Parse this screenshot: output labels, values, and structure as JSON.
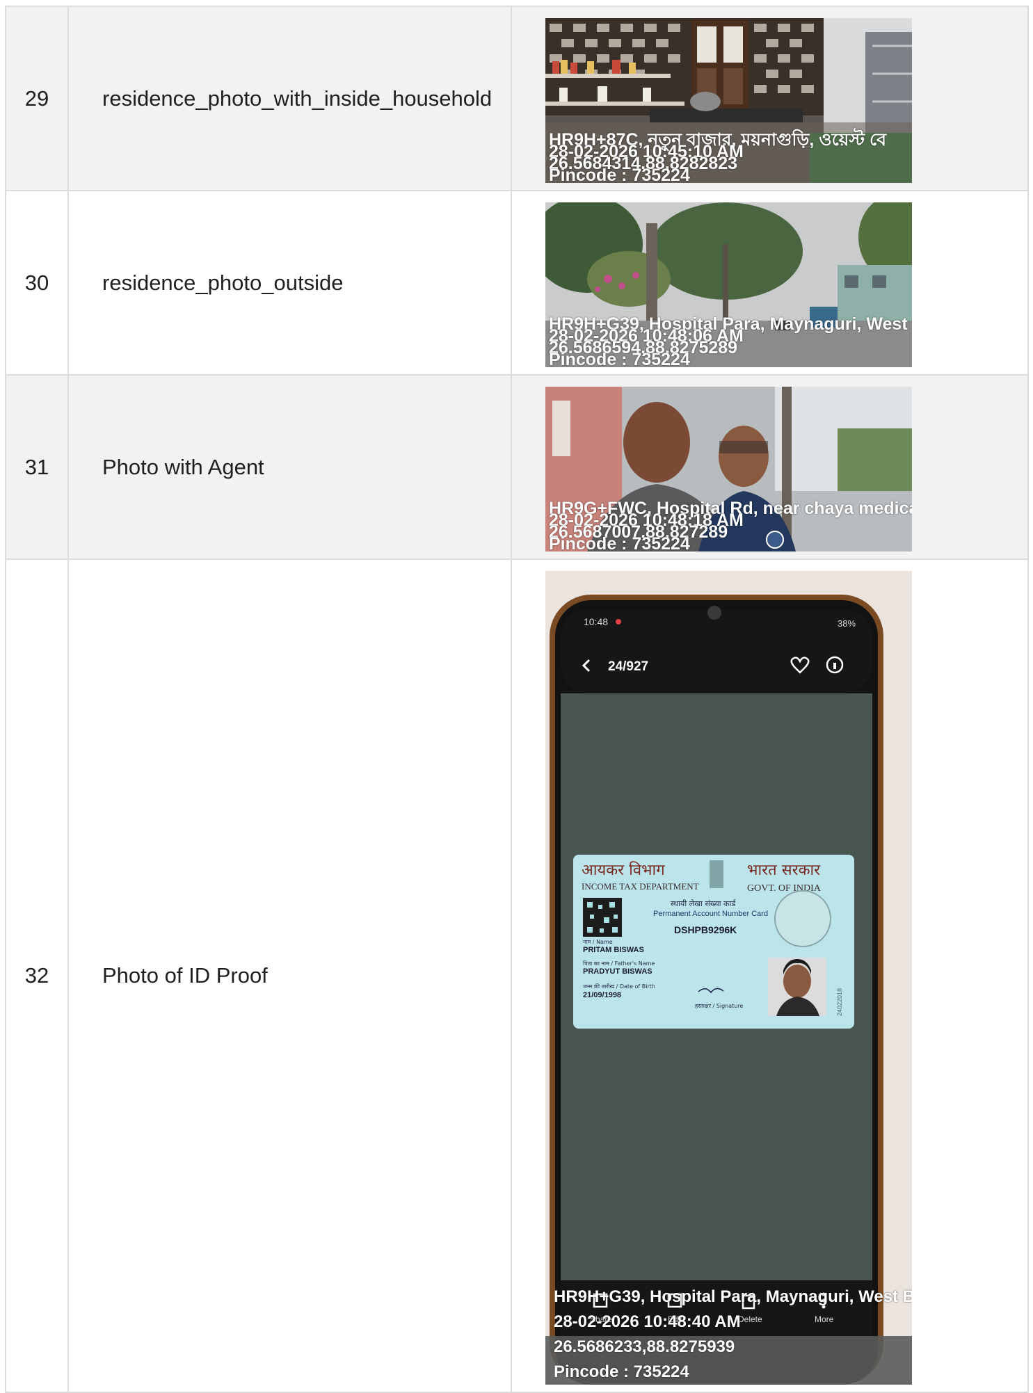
{
  "rows": [
    {
      "number": "29",
      "label": "residence_photo_with_inside_household",
      "stamp": {
        "address": "HR9H+87C, নতুন বাজার, ময়নাগুড়ি, ওয়েস্ট বে",
        "datetime": "28-02-2026 10:45:10 AM",
        "coords": "26.5684314,88.8282823",
        "pincode": "Pincode : 735224"
      }
    },
    {
      "number": "30",
      "label": "residence_photo_outside",
      "stamp": {
        "address": "HR9H+G39, Hospital Para, Maynaguri, West",
        "datetime": "28-02-2026 10:48:06 AM",
        "coords": "26.5686594,88.8275289",
        "pincode": "Pincode : 735224"
      }
    },
    {
      "number": "31",
      "label": "Photo with Agent",
      "stamp": {
        "address": "HR9G+FWC, Hospital Rd, near chaya medica",
        "datetime": "28-02-2026 10:48:18 AM",
        "coords": "26.5687007,88.827289",
        "pincode": "Pincode : 735224"
      }
    },
    {
      "number": "32",
      "label": "Photo of ID Proof",
      "phone": {
        "status_time": "10:48",
        "battery": "38%",
        "gallery_counter": "24/927",
        "actions": [
          "Share",
          "Edit",
          "Delete",
          "More"
        ]
      },
      "card": {
        "dept_hindi": "आयकर विभाग",
        "govt_hindi": "भारत सरकार",
        "dept_english": "INCOME TAX DEPARTMENT",
        "govt_english": "GOVT. OF INDIA",
        "card_title_hindi": "स्थायी लेखा संख्या कार्ड",
        "card_title": "Permanent Account Number Card",
        "pan_number": "DSHPB9296K",
        "name_caption": "नाम / Name",
        "name": "PRITAM BISWAS",
        "father_caption": "पिता का नाम / Father's Name",
        "father_name": "PRADYUT BISWAS",
        "dob_caption": "जन्म की तारीख / Date of Birth",
        "dob": "21/09/1998",
        "signature_caption": "हस्ताक्षर / Signature",
        "side_code": "24022018"
      },
      "stamp": {
        "address": "HR9H+G39, Hospital Para, Maynaguri, West B",
        "datetime": "28-02-2026 10:48:40 AM",
        "coords": "26.5686233,88.8275939",
        "pincode": "Pincode : 735224"
      }
    }
  ]
}
